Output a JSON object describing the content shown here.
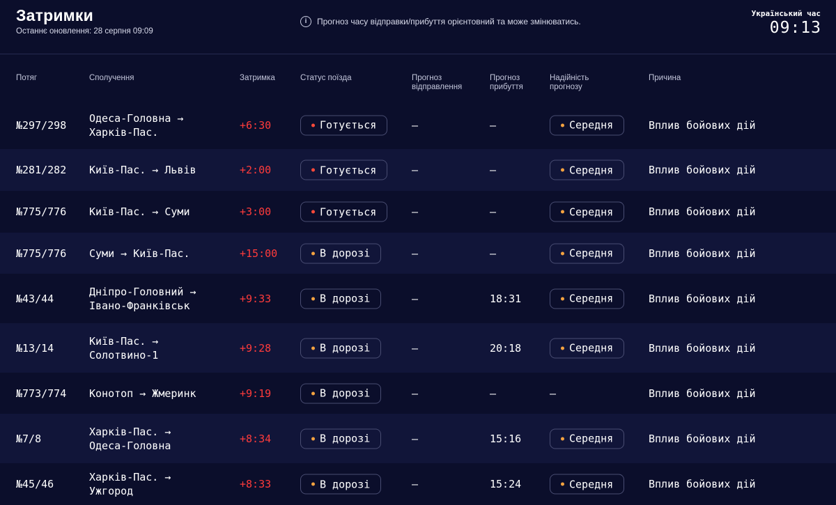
{
  "header": {
    "title": "Затримки",
    "updated": "Останнє оновлення: 28 серпня 09:09",
    "notice": "Прогноз часу відправки/прибуття орієнтовний та може змінюватись.",
    "clock_label": "Український час",
    "clock_time": "09:13"
  },
  "columns": {
    "train": "Потяг",
    "route": "Сполучення",
    "delay": "Затримка",
    "status": "Статус поїзда",
    "dep_forecast": "Прогноз\nвідправлення",
    "arr_forecast": "Прогноз\nприбуття",
    "reliability": "Надійність\nпрогнозу",
    "reason": "Причина"
  },
  "colors": {
    "status_preparing_dot": "#ff4a3a",
    "status_en_route_dot": "#f5a340",
    "reliability_dot": "#f5a340",
    "delay_text": "#ff3b3b"
  },
  "rows": [
    {
      "train": "№297/298",
      "route": "Одеса-Головна →\nХарків-Пас.",
      "delay": "+6:30",
      "status": "Готується",
      "status_kind": "preparing",
      "dep": "—",
      "arr": "—",
      "reliability": "Середня",
      "reason": "Вплив бойових дій"
    },
    {
      "train": "№281/282",
      "route": "Київ-Пас. → Львів",
      "delay": "+2:00",
      "status": "Готується",
      "status_kind": "preparing",
      "dep": "—",
      "arr": "—",
      "reliability": "Середня",
      "reason": "Вплив бойових дій"
    },
    {
      "train": "№775/776",
      "route": "Київ-Пас. → Суми",
      "delay": "+3:00",
      "status": "Готується",
      "status_kind": "preparing",
      "dep": "—",
      "arr": "—",
      "reliability": "Середня",
      "reason": "Вплив бойових дій"
    },
    {
      "train": "№775/776",
      "route": "Суми → Київ-Пас.",
      "delay": "+15:00",
      "status": "В дорозі",
      "status_kind": "en_route",
      "dep": "—",
      "arr": "—",
      "reliability": "Середня",
      "reason": "Вплив бойових дій"
    },
    {
      "train": "№43/44",
      "route": "Дніпро-Головний →\nІвано-Франківськ",
      "delay": "+9:33",
      "status": "В дорозі",
      "status_kind": "en_route",
      "dep": "—",
      "arr": "18:31",
      "reliability": "Середня",
      "reason": "Вплив бойових дій"
    },
    {
      "train": "№13/14",
      "route": "Київ-Пас. →\nСолотвино-1",
      "delay": "+9:28",
      "status": "В дорозі",
      "status_kind": "en_route",
      "dep": "—",
      "arr": "20:18",
      "reliability": "Середня",
      "reason": "Вплив бойових дій"
    },
    {
      "train": "№773/774",
      "route": "Конотоп → Жмеринк",
      "delay": "+9:19",
      "status": "В дорозі",
      "status_kind": "en_route",
      "dep": "—",
      "arr": "—",
      "reliability": "—",
      "reason": "Вплив бойових дій"
    },
    {
      "train": "№7/8",
      "route": "Харків-Пас. →\nОдеса-Головна",
      "delay": "+8:34",
      "status": "В дорозі",
      "status_kind": "en_route",
      "dep": "—",
      "arr": "15:16",
      "reliability": "Середня",
      "reason": "Вплив бойових дій"
    },
    {
      "train": "№45/46",
      "route": "Харків-Пас. →\nУжгород",
      "delay": "+8:33",
      "status": "В дорозі",
      "status_kind": "en_route",
      "dep": "—",
      "arr": "15:24",
      "reliability": "Середня",
      "reason": "Вплив бойових дій"
    }
  ]
}
